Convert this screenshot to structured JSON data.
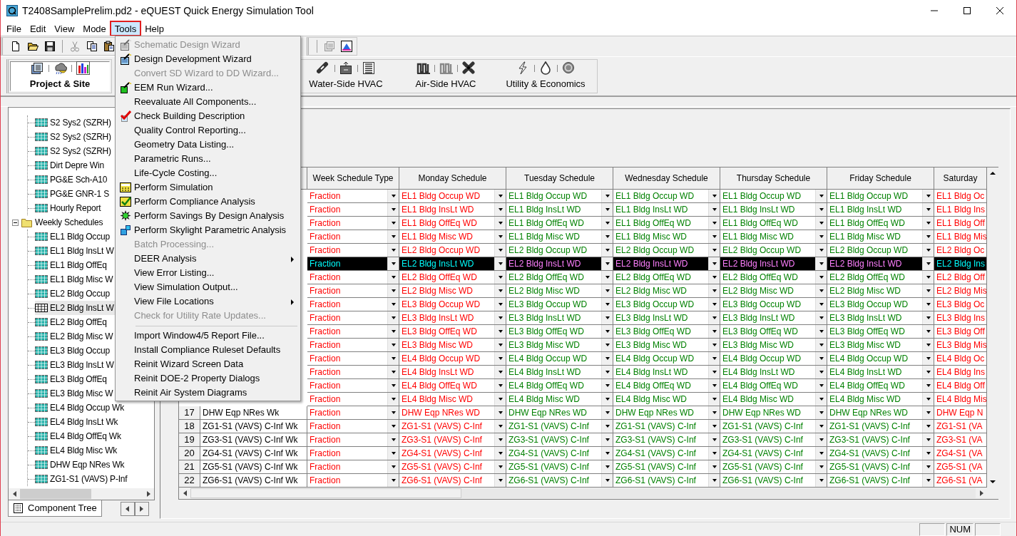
{
  "window": {
    "title": "T2408SamplePrelim.pd2 - eQUEST Quick Energy Simulation Tool"
  },
  "menu_bar": [
    {
      "label": "File",
      "selected": false
    },
    {
      "label": "Edit",
      "selected": false
    },
    {
      "label": "View",
      "selected": false
    },
    {
      "label": "Mode",
      "selected": false
    },
    {
      "label": "Tools",
      "selected": true
    },
    {
      "label": "Help",
      "selected": false
    }
  ],
  "mode_bar": {
    "groups": [
      {
        "buttons": [
          {
            "label": "Project & Site",
            "selected": true
          }
        ]
      },
      {
        "buttons": [
          {
            "label": "Water-Side HVAC",
            "selected": false
          },
          {
            "label": "Air-Side HVAC",
            "selected": false
          },
          {
            "label": "Utility & Economics",
            "selected": false
          }
        ]
      }
    ]
  },
  "tools_menu": {
    "items": [
      {
        "kind": "wizard",
        "label": "Schematic Design Wizard",
        "disabled": true
      },
      {
        "kind": "wizard",
        "label": "Design Development Wizard",
        "disabled": false
      },
      {
        "kind": "plain",
        "label": "Convert SD Wizard to DD Wizard...",
        "disabled": true
      },
      {
        "kind": "eem",
        "label": "EEM Run Wizard...",
        "disabled": false
      },
      {
        "kind": "plain",
        "label": "Reevaluate All Components...",
        "disabled": false
      },
      {
        "kind": "check",
        "label": "Check Building Description",
        "disabled": false
      },
      {
        "kind": "plain",
        "label": "Quality Control Reporting...",
        "disabled": false
      },
      {
        "kind": "plain",
        "label": "Geometry Data Listing...",
        "disabled": false
      },
      {
        "kind": "plain",
        "label": "Parametric Runs...",
        "disabled": false
      },
      {
        "kind": "plain",
        "label": "Life-Cycle Costing...",
        "disabled": false
      },
      {
        "kind": "simulation",
        "label": "Perform Simulation",
        "disabled": false
      },
      {
        "kind": "compliance",
        "label": "Perform Compliance Analysis",
        "disabled": false
      },
      {
        "kind": "savings",
        "label": "Perform Savings By Design Analysis",
        "disabled": false
      },
      {
        "kind": "skylight",
        "label": "Perform Skylight Parametric Analysis",
        "disabled": false
      },
      {
        "kind": "plain",
        "label": "Batch Processing...",
        "disabled": true
      },
      {
        "kind": "submenu",
        "label": "DEER Analysis",
        "disabled": false
      },
      {
        "kind": "plain",
        "label": "View Error Listing...",
        "disabled": false
      },
      {
        "kind": "plain",
        "label": "View Simulation Output...",
        "disabled": false
      },
      {
        "kind": "submenu",
        "label": "View File Locations",
        "disabled": false
      },
      {
        "kind": "plain",
        "label": "Check for Utility Rate Updates...",
        "disabled": true
      },
      {
        "kind": "separator"
      },
      {
        "kind": "plain",
        "label": "Import Window4/5 Report File...",
        "disabled": false
      },
      {
        "kind": "plain",
        "label": "Install Compliance Ruleset Defaults",
        "disabled": false
      },
      {
        "kind": "plain",
        "label": "Reinit Wizard Screen Data",
        "disabled": false
      },
      {
        "kind": "plain",
        "label": "Reinit DOE-2 Property Dialogs",
        "disabled": false
      },
      {
        "kind": "plain",
        "label": "Reinit Air System Diagrams",
        "disabled": false
      }
    ]
  },
  "component_tree": {
    "items": [
      {
        "children": [
          {
            "label": "S2 Sys2 (SZRH)",
            "selected": false
          },
          {
            "label": "S2 Sys2 (SZRH)",
            "selected": false
          },
          {
            "label": "S2 Sys2 (SZRH)",
            "selected": false
          },
          {
            "label": "Dirt Depre Win",
            "selected": false
          },
          {
            "label": "PG&E Sch-A10",
            "selected": false
          },
          {
            "label": "PG&E GNR-1 S",
            "selected": false
          },
          {
            "label": "Hourly Report",
            "selected": false
          }
        ]
      },
      {
        "label": "Weekly Schedules",
        "expanded": true,
        "children": [
          {
            "label": "EL1 Bldg Occup",
            "selected": false
          },
          {
            "label": "EL1 Bldg InsLt W",
            "selected": false
          },
          {
            "label": "EL1 Bldg OffEq",
            "selected": false
          },
          {
            "label": "EL1 Bldg Misc W",
            "selected": false
          },
          {
            "label": "EL2 Bldg Occup",
            "selected": false
          },
          {
            "label": "EL2 Bldg InsLt W",
            "selected": true
          },
          {
            "label": "EL2 Bldg OffEq",
            "selected": false
          },
          {
            "label": "EL2 Bldg Misc W",
            "selected": false
          },
          {
            "label": "EL3 Bldg Occup",
            "selected": false
          },
          {
            "label": "EL3 Bldg InsLt W",
            "selected": false
          },
          {
            "label": "EL3 Bldg OffEq",
            "selected": false
          },
          {
            "label": "EL3 Bldg Misc W",
            "selected": false
          },
          {
            "label": "EL4 Bldg Occup Wk",
            "selected": false
          },
          {
            "label": "EL4 Bldg InsLt Wk",
            "selected": false
          },
          {
            "label": "EL4 Bldg OffEq Wk",
            "selected": false
          },
          {
            "label": "EL4 Bldg Misc Wk",
            "selected": false
          },
          {
            "label": "DHW Eqp NRes Wk",
            "selected": false
          },
          {
            "label": "ZG1-S1 (VAVS) P-Inf",
            "selected": false
          }
        ]
      }
    ]
  },
  "tree_tab": {
    "label": "Component Tree",
    "selected": true
  },
  "grid": {
    "columns": [
      {
        "label": "Week Schedule Type",
        "color": "#ff0000"
      },
      {
        "label": "Monday Schedule",
        "color": "#ff0000"
      },
      {
        "label": "Tuesday Schedule",
        "color": "#008000"
      },
      {
        "label": "Wednesday Schedule",
        "color": "#008000"
      },
      {
        "label": "Thursday Schedule",
        "color": "#008000"
      },
      {
        "label": "Friday Schedule",
        "color": "#008000"
      },
      {
        "label": "Saturday",
        "color": "#ff0000"
      }
    ],
    "rows": [
      {
        "selected": false,
        "cells": [
          "Fraction",
          "EL1 Bldg Occup WD",
          "EL1 Bldg Occup WD",
          "EL1 Bldg Occup WD",
          "EL1 Bldg Occup WD",
          "EL1 Bldg Occup WD",
          "EL1 Bldg Oc"
        ]
      },
      {
        "selected": false,
        "cells": [
          "Fraction",
          "EL1 Bldg InsLt WD",
          "EL1 Bldg InsLt WD",
          "EL1 Bldg InsLt WD",
          "EL1 Bldg InsLt WD",
          "EL1 Bldg InsLt WD",
          "EL1 Bldg Ins"
        ]
      },
      {
        "selected": false,
        "cells": [
          "Fraction",
          "EL1 Bldg OffEq WD",
          "EL1 Bldg OffEq WD",
          "EL1 Bldg OffEq WD",
          "EL1 Bldg OffEq WD",
          "EL1 Bldg OffEq WD",
          "EL1 Bldg Off"
        ]
      },
      {
        "selected": false,
        "cells": [
          "Fraction",
          "EL1 Bldg Misc WD",
          "EL1 Bldg Misc WD",
          "EL1 Bldg Misc WD",
          "EL1 Bldg Misc WD",
          "EL1 Bldg Misc WD",
          "EL1 Bldg Mis"
        ]
      },
      {
        "selected": false,
        "cells": [
          "Fraction",
          "EL2 Bldg Occup WD",
          "EL2 Bldg Occup WD",
          "EL2 Bldg Occup WD",
          "EL2 Bldg Occup WD",
          "EL2 Bldg Occup WD",
          "EL2 Bldg Oc"
        ]
      },
      {
        "selected": true,
        "cells": [
          "Fraction",
          "EL2 Bldg InsLt WD",
          "EL2 Bldg InsLt WD",
          "EL2 Bldg InsLt WD",
          "EL2 Bldg InsLt WD",
          "EL2 Bldg InsLt WD",
          "EL2 Bldg Ins"
        ]
      },
      {
        "selected": false,
        "cells": [
          "Fraction",
          "EL2 Bldg OffEq WD",
          "EL2 Bldg OffEq WD",
          "EL2 Bldg OffEq WD",
          "EL2 Bldg OffEq WD",
          "EL2 Bldg OffEq WD",
          "EL2 Bldg Off"
        ]
      },
      {
        "selected": false,
        "cells": [
          "Fraction",
          "EL2 Bldg Misc WD",
          "EL2 Bldg Misc WD",
          "EL2 Bldg Misc WD",
          "EL2 Bldg Misc WD",
          "EL2 Bldg Misc WD",
          "EL2 Bldg Mis"
        ]
      },
      {
        "selected": false,
        "cells": [
          "Fraction",
          "EL3 Bldg Occup WD",
          "EL3 Bldg Occup WD",
          "EL3 Bldg Occup WD",
          "EL3 Bldg Occup WD",
          "EL3 Bldg Occup WD",
          "EL3 Bldg Oc"
        ]
      },
      {
        "selected": false,
        "cells": [
          "Fraction",
          "EL3 Bldg InsLt WD",
          "EL3 Bldg InsLt WD",
          "EL3 Bldg InsLt WD",
          "EL3 Bldg InsLt WD",
          "EL3 Bldg InsLt WD",
          "EL3 Bldg Ins"
        ]
      },
      {
        "selected": false,
        "cells": [
          "Fraction",
          "EL3 Bldg OffEq WD",
          "EL3 Bldg OffEq WD",
          "EL3 Bldg OffEq WD",
          "EL3 Bldg OffEq WD",
          "EL3 Bldg OffEq WD",
          "EL3 Bldg Off"
        ]
      },
      {
        "selected": false,
        "cells": [
          "Fraction",
          "EL3 Bldg Misc WD",
          "EL3 Bldg Misc WD",
          "EL3 Bldg Misc WD",
          "EL3 Bldg Misc WD",
          "EL3 Bldg Misc WD",
          "EL3 Bldg Mis"
        ]
      },
      {
        "selected": false,
        "cells": [
          "Fraction",
          "EL4 Bldg Occup WD",
          "EL4 Bldg Occup WD",
          "EL4 Bldg Occup WD",
          "EL4 Bldg Occup WD",
          "EL4 Bldg Occup WD",
          "EL4 Bldg Oc"
        ]
      },
      {
        "selected": false,
        "cells": [
          "Fraction",
          "EL4 Bldg InsLt WD",
          "EL4 Bldg InsLt WD",
          "EL4 Bldg InsLt WD",
          "EL4 Bldg InsLt WD",
          "EL4 Bldg InsLt WD",
          "EL4 Bldg Ins"
        ]
      },
      {
        "selected": false,
        "cells": [
          "Fraction",
          "EL4 Bldg OffEq WD",
          "EL4 Bldg OffEq WD",
          "EL4 Bldg OffEq WD",
          "EL4 Bldg OffEq WD",
          "EL4 Bldg OffEq WD",
          "EL4 Bldg Off"
        ]
      },
      {
        "selected": false,
        "cells": [
          "Fraction",
          "EL4 Bldg Misc WD",
          "EL4 Bldg Misc WD",
          "EL4 Bldg Misc WD",
          "EL4 Bldg Misc WD",
          "EL4 Bldg Misc WD",
          "EL4 Bldg Mis"
        ]
      },
      {
        "number": "17",
        "name": "DHW Eqp NRes Wk",
        "selected": false,
        "cells": [
          "Fraction",
          "DHW Eqp NRes WD",
          "DHW Eqp NRes WD",
          "DHW Eqp NRes WD",
          "DHW Eqp NRes WD",
          "DHW Eqp NRes WD",
          "DHW Eqp N"
        ]
      },
      {
        "number": "18",
        "name": "ZG1-S1 (VAVS) C-Inf Wk",
        "selected": false,
        "cells": [
          "Fraction",
          "ZG1-S1 (VAVS) C-Inf",
          "ZG1-S1 (VAVS) C-Inf",
          "ZG1-S1 (VAVS) C-Inf",
          "ZG1-S1 (VAVS) C-Inf",
          "ZG1-S1 (VAVS) C-Inf",
          "ZG1-S1 (VA"
        ]
      },
      {
        "number": "19",
        "name": "ZG3-S1 (VAVS) C-Inf Wk",
        "selected": false,
        "cells": [
          "Fraction",
          "ZG3-S1 (VAVS) C-Inf",
          "ZG3-S1 (VAVS) C-Inf",
          "ZG3-S1 (VAVS) C-Inf",
          "ZG3-S1 (VAVS) C-Inf",
          "ZG3-S1 (VAVS) C-Inf",
          "ZG3-S1 (VA"
        ]
      },
      {
        "number": "20",
        "name": "ZG4-S1 (VAVS) C-Inf Wk",
        "selected": false,
        "cells": [
          "Fraction",
          "ZG4-S1 (VAVS) C-Inf",
          "ZG4-S1 (VAVS) C-Inf",
          "ZG4-S1 (VAVS) C-Inf",
          "ZG4-S1 (VAVS) C-Inf",
          "ZG4-S1 (VAVS) C-Inf",
          "ZG4-S1 (VA"
        ]
      },
      {
        "number": "21",
        "name": "ZG5-S1 (VAVS) C-Inf Wk",
        "selected": false,
        "cells": [
          "Fraction",
          "ZG5-S1 (VAVS) C-Inf",
          "ZG5-S1 (VAVS) C-Inf",
          "ZG5-S1 (VAVS) C-Inf",
          "ZG5-S1 (VAVS) C-Inf",
          "ZG5-S1 (VAVS) C-Inf",
          "ZG5-S1 (VA"
        ]
      },
      {
        "number": "22",
        "name": "ZG6-S1 (VAVS) C-Inf Wk",
        "selected": false,
        "cells": [
          "Fraction",
          "ZG6-S1 (VAVS) C-Inf",
          "ZG6-S1 (VAVS) C-Inf",
          "ZG6-S1 (VAVS) C-Inf",
          "ZG6-S1 (VAVS) C-Inf",
          "ZG6-S1 (VAVS) C-Inf",
          "ZG6-S1 (VA"
        ]
      }
    ]
  },
  "status_bar": {
    "indicators": [
      "NUM"
    ]
  }
}
